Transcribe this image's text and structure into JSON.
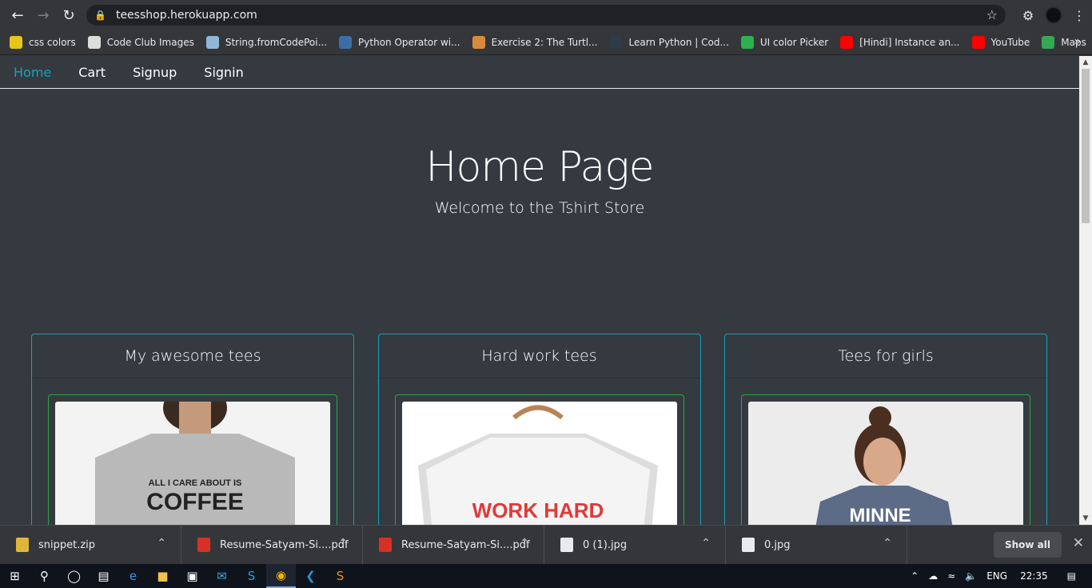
{
  "browser": {
    "url": "teesshop.herokuapp.com",
    "bookmarks": [
      {
        "label": "css colors",
        "color": "#e6c619"
      },
      {
        "label": "Code Club Images",
        "color": "#dcdcdc"
      },
      {
        "label": "String.fromCodePoi...",
        "color": "#8fb7d8"
      },
      {
        "label": "Python Operator wi...",
        "color": "#3b6ea8"
      },
      {
        "label": "Exercise 2: The Turtl...",
        "color": "#d88a3a"
      },
      {
        "label": "Learn Python | Cod...",
        "color": "#2e3b4a"
      },
      {
        "label": "UI color Picker",
        "color": "#2bb24c"
      },
      {
        "label": "[Hindi] Instance an...",
        "color": "#ff0000"
      },
      {
        "label": "YouTube",
        "color": "#ff0000"
      },
      {
        "label": "Maps",
        "color": "#34a853"
      }
    ]
  },
  "nav": {
    "home": "Home",
    "cart": "Cart",
    "signup": "Signup",
    "signin": "Signin"
  },
  "hero": {
    "title": "Home Page",
    "subtitle": "Welcome to the Tshirt Store"
  },
  "cards": [
    {
      "title": "My awesome tees",
      "print": "ALL I CARE ABOUT IS COFFEE",
      "bg": "#f3f3f3",
      "shirt": "#b9b9b9",
      "ink": "#222222"
    },
    {
      "title": "Hard work tees",
      "print": "WORK HARD",
      "bg": "#ffffff",
      "shirt": "#f4f4f4",
      "ink": "#e03a3a"
    },
    {
      "title": "Tees for girls",
      "print": "MINNE",
      "bg": "#ececec",
      "shirt": "#5c6b86",
      "ink": "#ffffff"
    }
  ],
  "downloads": [
    {
      "name": "snippet.zip",
      "type": "zip"
    },
    {
      "name": "Resume-Satyam-Si....pdf",
      "type": "pdf"
    },
    {
      "name": "Resume-Satyam-Si....pdf",
      "type": "pdf"
    },
    {
      "name": "0 (1).jpg",
      "type": "jpg"
    },
    {
      "name": "0.jpg",
      "type": "jpg"
    }
  ],
  "shelf": {
    "show_all": "Show all"
  },
  "taskbar": {
    "lang": "ENG",
    "time": "22:35"
  }
}
